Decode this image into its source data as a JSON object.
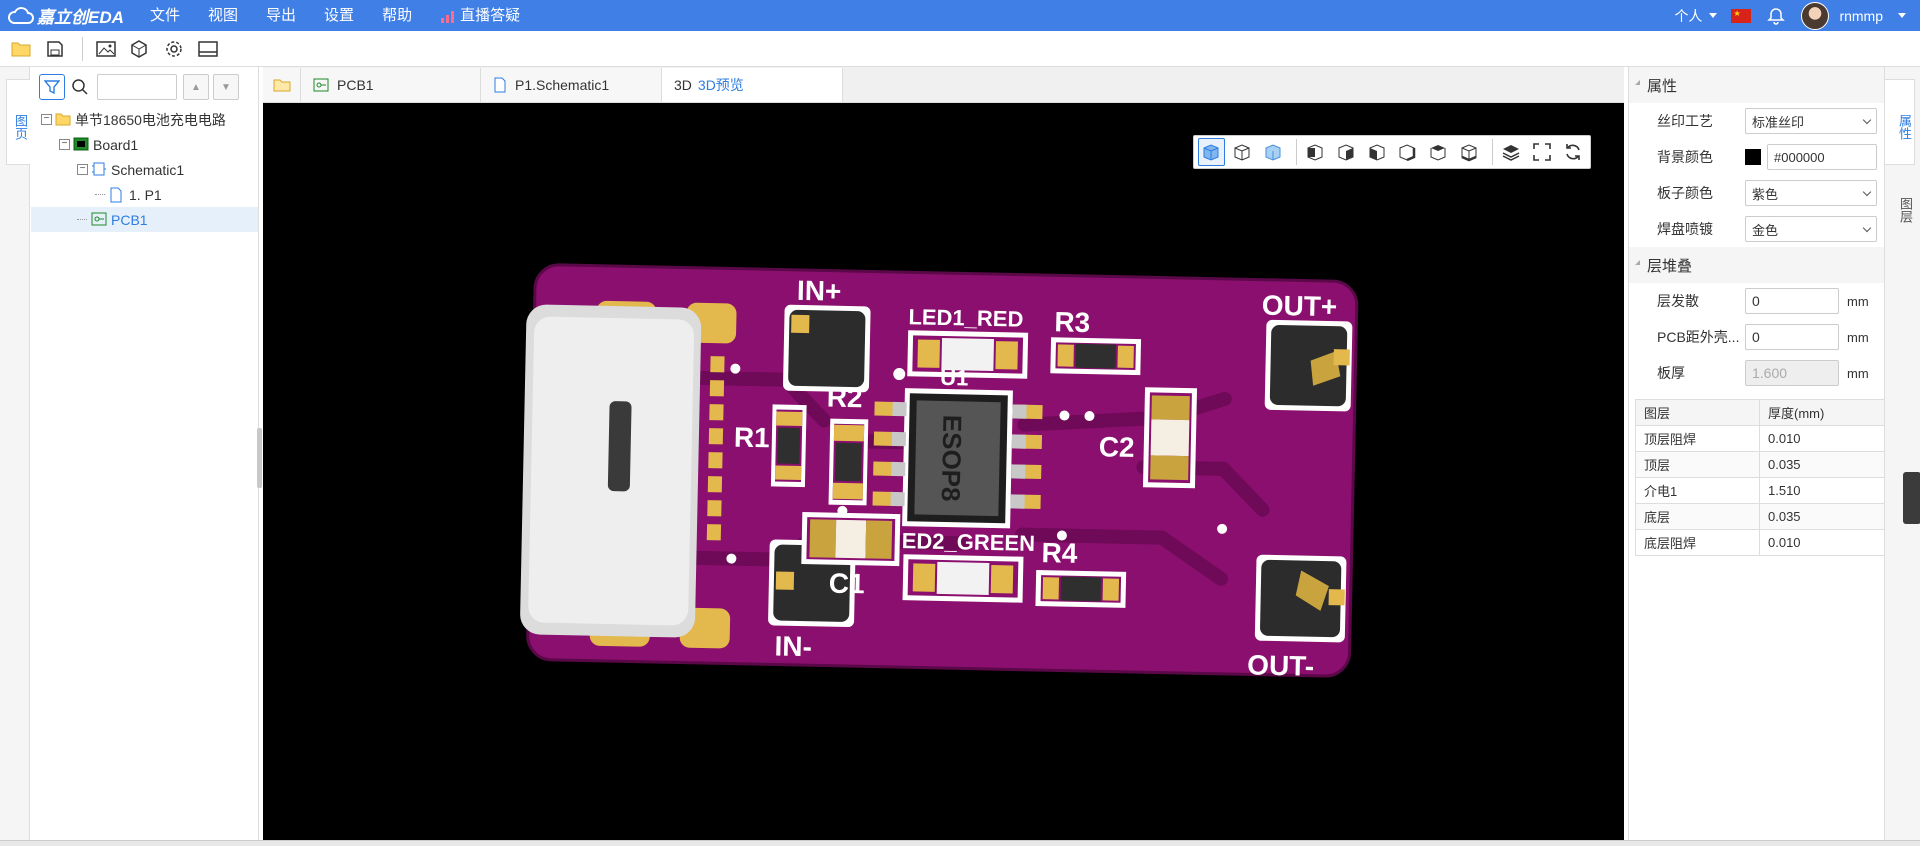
{
  "app": {
    "logo_text": "嘉立创EDA"
  },
  "menu": [
    "文件",
    "视图",
    "导出",
    "设置",
    "帮助"
  ],
  "live_menu": "直播答疑",
  "user": {
    "personal": "个人",
    "name": "rnmmp"
  },
  "left_tab": "图页",
  "tree": {
    "root": "单节18650电池充电电路",
    "board": "Board1",
    "schematic": "Schematic1",
    "page": "1. P1",
    "pcb": "PCB1"
  },
  "tabs": {
    "pcb": "PCB1",
    "schematic": "P1.Schematic1",
    "preview_prefix": "3D",
    "preview": "3D预览"
  },
  "properties": {
    "title": "属性",
    "silkscreen_label": "丝印工艺",
    "silkscreen_value": "标准丝印",
    "bg_color_label": "背景颜色",
    "bg_color_value": "#000000",
    "board_color_label": "板子颜色",
    "board_color_value": "紫色",
    "plating_label": "焊盘喷镀",
    "plating_value": "金色"
  },
  "stackup": {
    "title": "层堆叠",
    "spread_label": "层发散",
    "spread_value": "0",
    "spread_unit": "mm",
    "pcb_outside_label": "PCB距外壳...",
    "pcb_outside_value": "0",
    "pcb_outside_unit": "mm",
    "thickness_label": "板厚",
    "thickness_value": "1.600",
    "thickness_unit": "mm",
    "columns": [
      "图层",
      "厚度(mm)"
    ],
    "rows": [
      [
        "顶层阻焊",
        "0.010"
      ],
      [
        "顶层",
        "0.035"
      ],
      [
        "介电1",
        "1.510"
      ],
      [
        "底层",
        "0.035"
      ],
      [
        "底层阻焊",
        "0.010"
      ]
    ]
  },
  "right_tabs": {
    "active": "属性",
    "inactive": "图层"
  },
  "pcb_labels": {
    "in_plus": "IN+",
    "in_minus": "IN-",
    "out_plus": "OUT+",
    "out_minus": "OUT-",
    "led1": "LED1_RED",
    "led2": "ED2_GREEN",
    "r1": "R1",
    "r2": "R2",
    "r3": "R3",
    "r4": "R4",
    "c1": "C1",
    "c2": "C2",
    "u1": "U1",
    "chip": "ESOP8"
  },
  "colors": {
    "topbar": "#3f7fe6",
    "accent": "#2f7de1",
    "board": "#8b0f6e",
    "pad_gold": "#e3b84c"
  }
}
